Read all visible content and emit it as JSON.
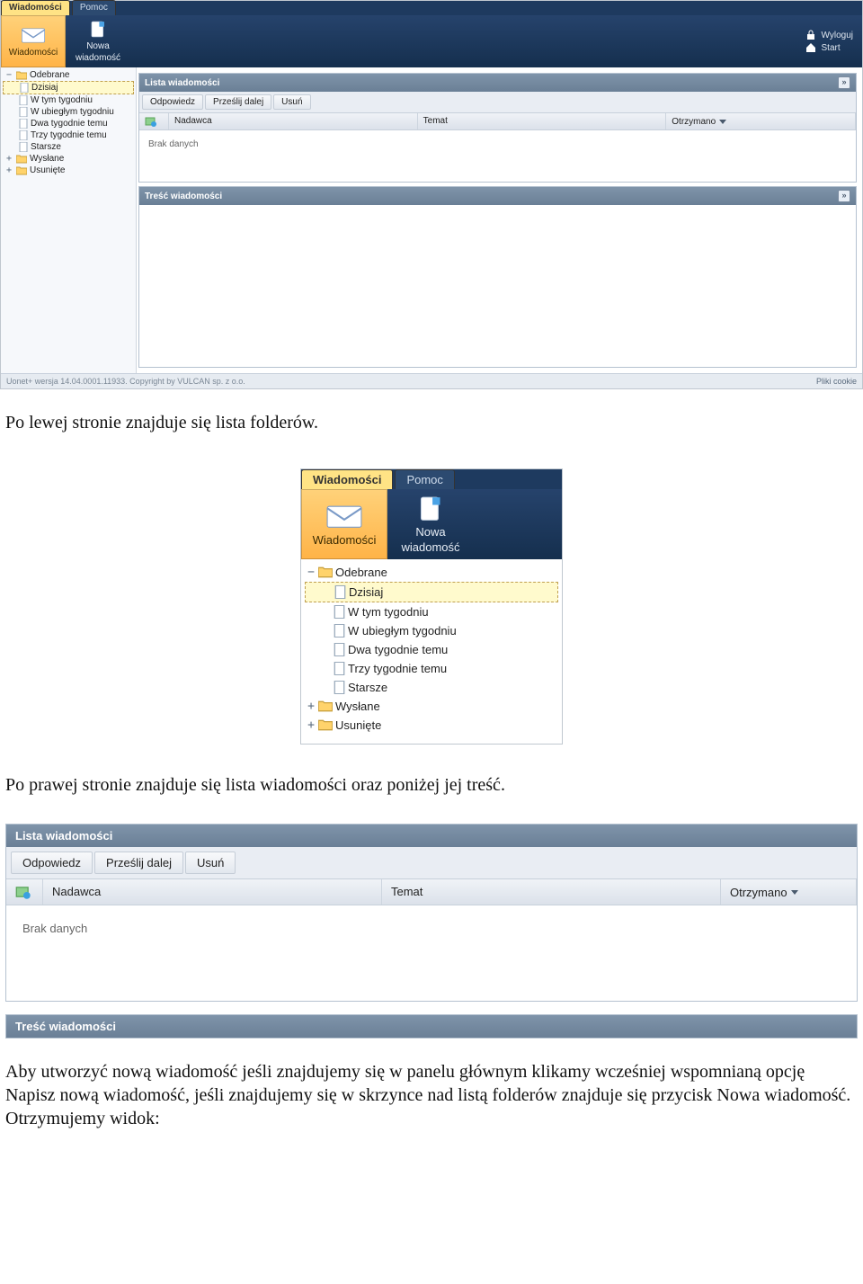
{
  "tabs": {
    "active": "Wiadomości",
    "inactive": "Pomoc"
  },
  "ribbon": {
    "messages": "Wiadomości",
    "new_line1": "Nowa",
    "new_line2": "wiadomość"
  },
  "user_actions": {
    "logout": "Wyloguj",
    "start": "Start"
  },
  "tree": {
    "inbox": "Odebrane",
    "today": "Dzisiaj",
    "this_week": "W tym tygodniu",
    "last_week": "W ubiegłym tygodniu",
    "two_weeks": "Dwa tygodnie temu",
    "three_weeks": "Trzy tygodnie temu",
    "older": "Starsze",
    "sent": "Wysłane",
    "trash": "Usunięte"
  },
  "list_panel": {
    "title": "Lista wiadomości",
    "btn_reply": "Odpowiedz",
    "btn_forward": "Prześlij dalej",
    "btn_delete": "Usuń",
    "col_sender": "Nadawca",
    "col_subject": "Temat",
    "col_received": "Otrzymano",
    "no_data": "Brak danych"
  },
  "content_panel": {
    "title": "Treść wiadomości"
  },
  "footer": {
    "left": "Uonet+ wersja 14.04.0001.11933. Copyright by VULCAN sp. z o.o.",
    "right": "Pliki cookie"
  },
  "doc": {
    "p1": "Po lewej stronie znajduje się lista folderów.",
    "p2": "Po prawej stronie znajduje się lista wiadomości oraz poniżej jej treść.",
    "p3": "Aby utworzyć nową wiadomość jeśli znajdujemy się w panelu głównym klikamy wcześniej wspomnianą opcję Napisz nową wiadomość, jeśli znajdujemy się w skrzynce nad listą folderów znajduje się przycisk Nowa wiadomość. Otrzymujemy widok:"
  }
}
